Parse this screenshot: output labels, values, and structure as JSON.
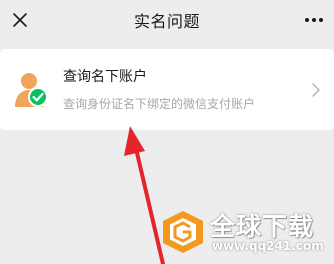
{
  "header": {
    "title": "实名问题",
    "close_icon": "close-icon",
    "more_icon": "more-icon"
  },
  "card": {
    "title": "查询名下账户",
    "subtitle": "查询身份证名下绑定的微信支付账户",
    "icon": "user-verified-icon",
    "chevron_icon": "chevron-right-icon"
  },
  "watermark": {
    "title": "全球下载",
    "url": "www.qq241.com"
  },
  "annotation": {
    "arrow_color": "#e3262b"
  },
  "colors": {
    "background": "#ededed",
    "card": "#ffffff",
    "accent_green": "#07c160",
    "icon_orange": "#f0a55a"
  }
}
